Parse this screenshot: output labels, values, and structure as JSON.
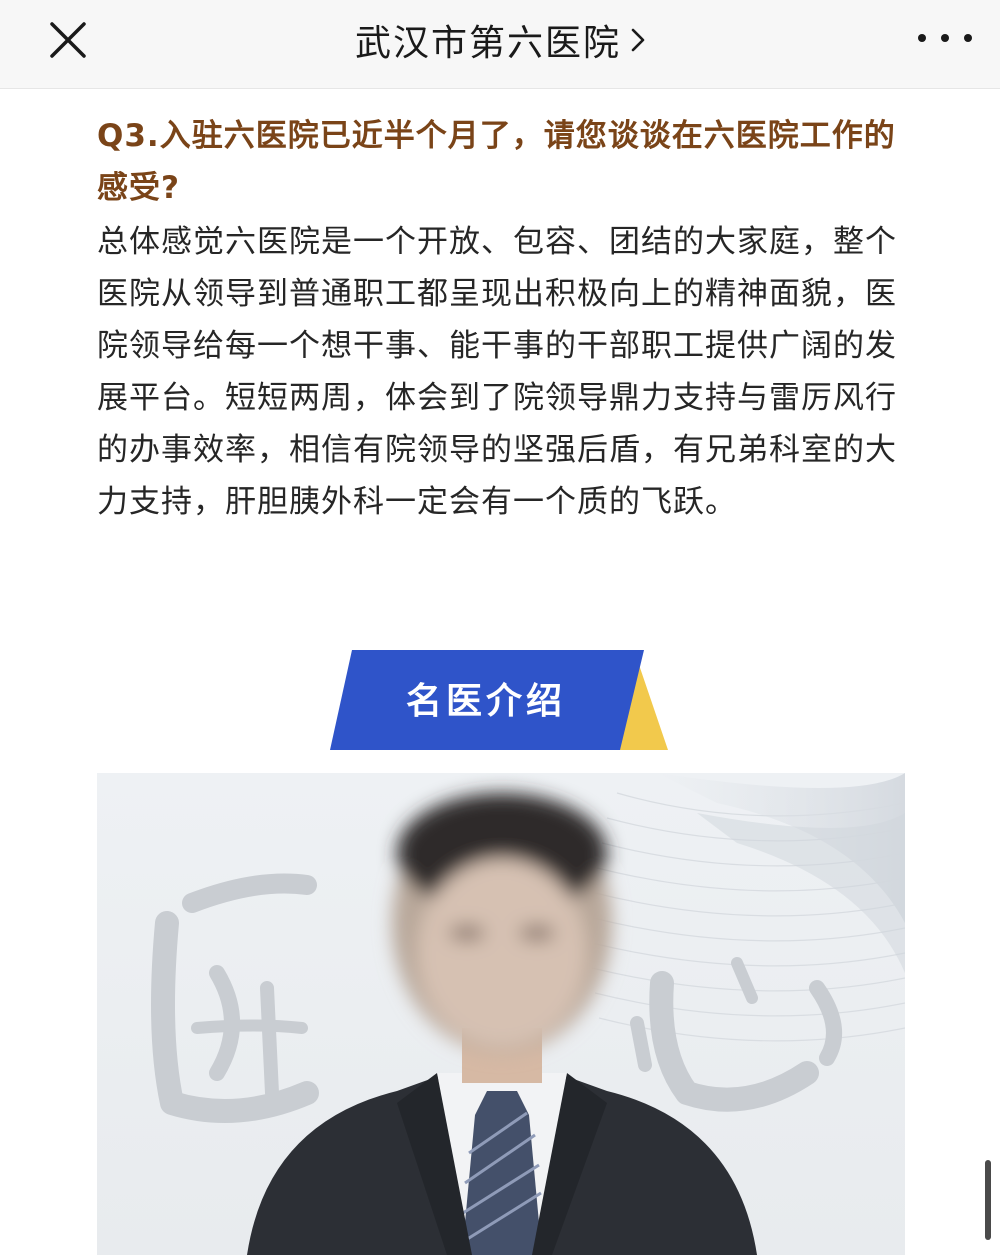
{
  "header": {
    "title": "武汉市第六医院",
    "close_icon": "close-icon",
    "chevron_icon": "chevron-right-icon",
    "more_icon": "more-horizontal-icon"
  },
  "article": {
    "question": "Q3.入驻六医院已近半个月了，请您谈谈在六医院工作的感受?",
    "answer": "总体感觉六医院是一个开放、包容、团结的大家庭，整个医院从领导到普通职工都呈现出积极向上的精神面貌，医院领导给每一个想干事、能干事的干部职工提供广阔的发展平台。短短两周，体会到了院领导鼎力支持与雷厉风行的办事效率，相信有院领导的坚强后盾，有兄弟科室的大力支持，肝胆胰外科一定会有一个质的飞跃。",
    "question_color": "#7a4418",
    "text_color": "#262626"
  },
  "section": {
    "banner_label": "名医介绍",
    "banner_color": "#2f54c9",
    "banner_accent_color": "#f2c94c"
  },
  "photo": {
    "calligraphy": "匠心",
    "description_icon": "doctor-portrait"
  }
}
